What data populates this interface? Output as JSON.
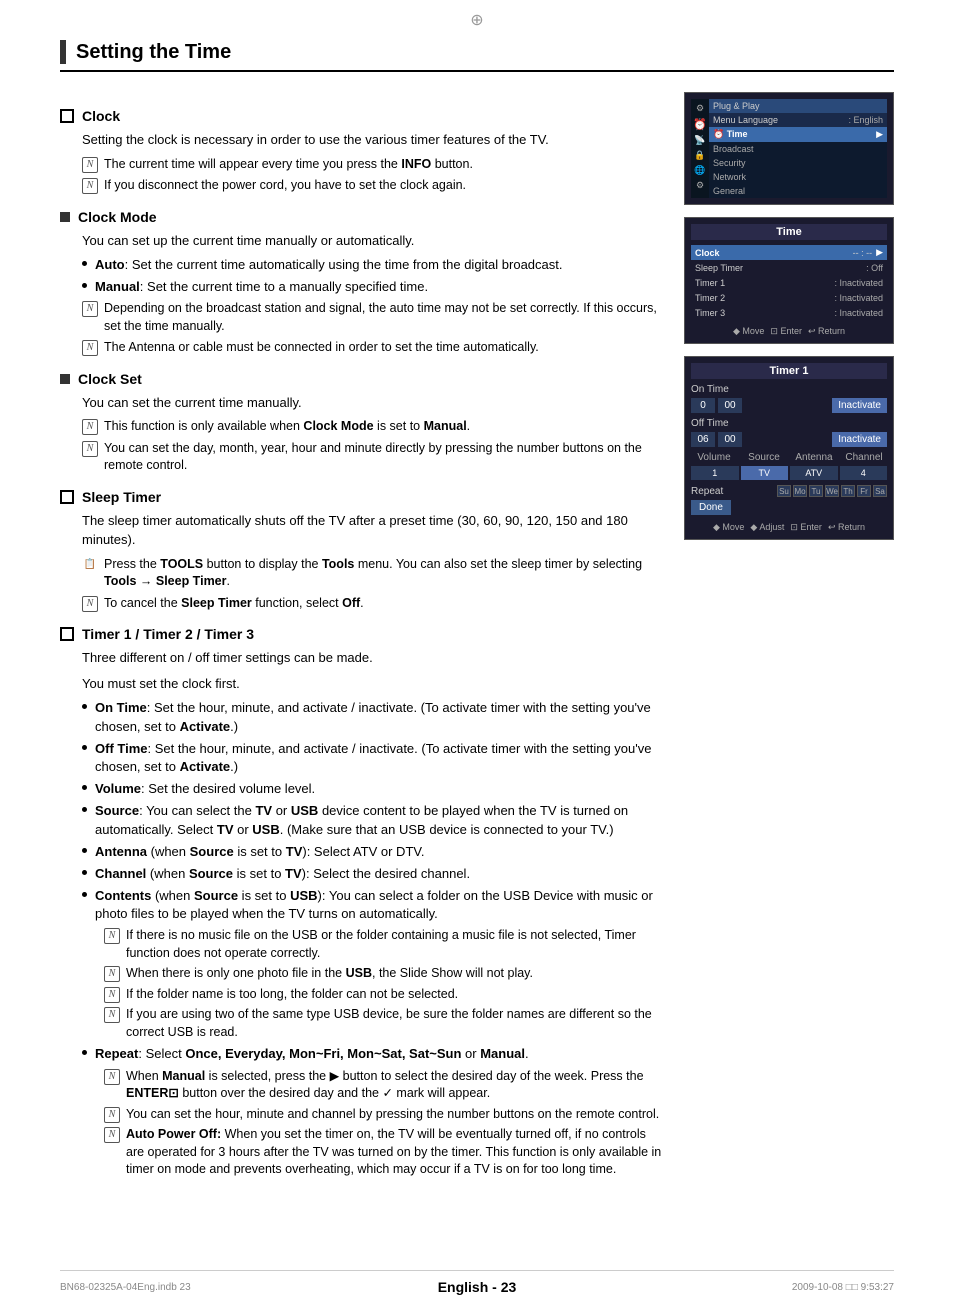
{
  "page": {
    "title": "Setting the Time",
    "footer_text": "English - 23",
    "footer_left": "BN68-02325A-04Eng.indb   23",
    "footer_right": "2009-10-08   □□  9:53:27"
  },
  "topics": [
    {
      "id": "clock",
      "type": "checkbox",
      "heading": "Clock",
      "body": "Setting the clock is necessary in order to use the various timer features of the TV.",
      "notes": [
        "The current time will appear every time you press the INFO button.",
        "If you disconnect the power cord, you have to set the clock again."
      ]
    },
    {
      "id": "clock-mode",
      "type": "square",
      "heading": "Clock Mode",
      "body": "You can set up the current time manually or automatically.",
      "bullets": [
        {
          "label": "Auto",
          "text": ": Set the current time automatically using the time from the digital broadcast."
        },
        {
          "label": "Manual",
          "text": ": Set the current time to a manually specified time."
        }
      ],
      "notes": [
        "Depending on the broadcast station and signal, the auto time may not be set correctly. If this occurs, set the time manually.",
        "The Antenna or cable must be connected in order to set the time automatically."
      ]
    },
    {
      "id": "clock-set",
      "type": "square",
      "heading": "Clock Set",
      "body": "You can set the current time manually.",
      "notes": [
        "This function is only available when Clock Mode is set to Manual.",
        "You can set the day, month, year, hour and minute directly by pressing the number buttons on the remote control."
      ]
    },
    {
      "id": "sleep-timer",
      "type": "checkbox",
      "heading": "Sleep Timer",
      "body": "The sleep timer automatically shuts off the TV after a preset time (30, 60, 90, 120, 150 and 180 minutes).",
      "reminder": "Press the TOOLS button to display the Tools menu. You can also set the sleep timer by selecting Tools → Sleep Timer.",
      "notes": [
        "To cancel the Sleep Timer function, select Off."
      ]
    },
    {
      "id": "timer",
      "type": "checkbox",
      "heading": "Timer 1 / Timer 2 / Timer 3",
      "body1": "Three different on / off timer settings can be made.",
      "body2": "You must set the clock first.",
      "bullets": [
        {
          "label": "On Time",
          "text": ": Set the hour, minute, and activate / inactivate. (To activate timer with the setting you've chosen, set to Activate.)"
        },
        {
          "label": "Off Time",
          "text": ": Set the hour, minute, and activate / inactivate. (To activate timer with the setting you've chosen, set to Activate.)"
        },
        {
          "label": "Volume",
          "text": ": Set the desired volume level."
        },
        {
          "label": "Source",
          "text": ": You can select the TV or USB device content to be played when the TV is turned on automatically. Select TV or USB. (Make sure that an USB device is connected to your TV.)"
        },
        {
          "label": "Antenna",
          "text": " (when Source is set to TV): Select ATV or DTV."
        },
        {
          "label": "Channel",
          "text": " (when Source is set to TV): Select the desired channel."
        },
        {
          "label": "Contents",
          "text": " (when Source is set to USB): You can select a folder on the USB Device with music or photo files to be played when the TV turns on automatically."
        }
      ],
      "contents_notes": [
        "If there is no music file on the USB or the folder containing a music file is not selected, Timer function does not operate correctly.",
        "When there is only one photo file in the USB, the Slide Show will not play.",
        "If the folder name is too long, the folder can not be selected.",
        "If you are using two of the same type USB device, be sure the folder names are different so the correct USB is read."
      ],
      "repeat_bullets": [
        {
          "label": "Repeat",
          "text": ": Select Once, Everyday, Mon~Fri, Mon~Sat, Sat~Sun or Manual."
        }
      ],
      "repeat_notes": [
        "When Manual is selected, press the ▶ button to select the desired day of the week. Press the ENTER⊡ button over the desired day and the ✓ mark will appear.",
        "You can set the hour, minute and channel by pressing the number buttons on the remote control.",
        "Auto Power Off: When you set the timer on, the TV will be eventually turned off, if no controls are operated for 3 hours after the TV was turned on by the timer. This function is only available in timer on mode and prevents overheating, which may occur if a TV is on for too long time."
      ]
    }
  ],
  "screenshots": {
    "menu1": {
      "title": "",
      "plug_play": "Plug & Play",
      "menu_language": "Menu Language",
      "menu_language_value": ": English",
      "time_label": "Time",
      "items": [
        "Broadcast",
        "Security",
        "Network",
        "General"
      ]
    },
    "menu2": {
      "title": "Time",
      "rows": [
        {
          "label": "Clock",
          "value": "-- : --",
          "arrow": true
        },
        {
          "label": "Sleep Timer",
          "value": ": Off"
        },
        {
          "label": "Timer 1",
          "value": ": Inactivated"
        },
        {
          "label": "Timer 2",
          "value": ": Inactivated"
        },
        {
          "label": "Timer 3",
          "value": ": Inactivated"
        }
      ],
      "nav": "◆ Move  ⊡ Enter  ↩ Return"
    },
    "timer1": {
      "title": "Timer 1",
      "on_time_label": "On Time",
      "on_inputs": [
        "0",
        "00",
        "Inactivate"
      ],
      "off_time_label": "Off Time",
      "off_inputs": [
        "06",
        "00",
        "Inactivate"
      ],
      "section_labels": [
        "Volume",
        "Source",
        "Antenna",
        "Channel"
      ],
      "section_values": [
        "1",
        "TV",
        "ATV",
        "4"
      ],
      "repeat_label": "Repeat",
      "days": [
        "Sun",
        "Mon",
        "Tue",
        "Wed",
        "Thu",
        "Fri",
        "Sat"
      ],
      "done_label": "Done",
      "nav": "◆ Move  ◆ Adjust  ⊡ Enter  ↩ Return"
    }
  },
  "icons": {
    "note_icon": "N",
    "reminder_icon": "🔔",
    "checkbox_empty": "□",
    "bullet_dot": "●"
  }
}
